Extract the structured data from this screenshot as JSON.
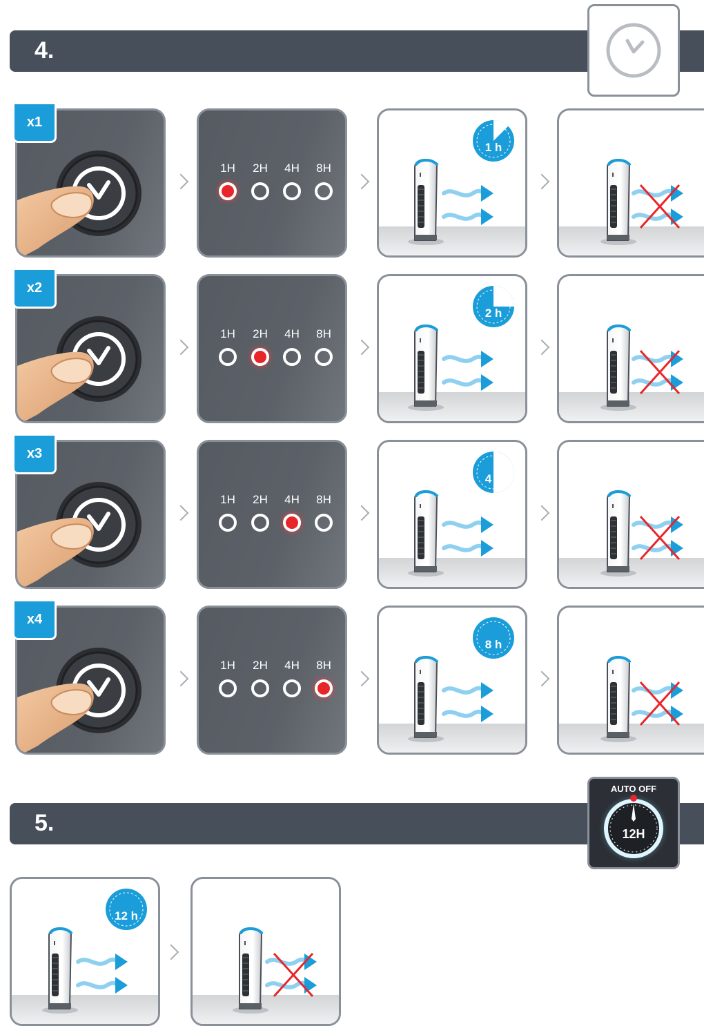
{
  "section4": {
    "number": "4."
  },
  "section5": {
    "number": "5.",
    "auto_off_title": "AUTO OFF",
    "auto_off_value": "12H"
  },
  "led_labels": [
    "1H",
    "2H",
    "4H",
    "8H"
  ],
  "rows": [
    {
      "press_count": "x1",
      "active_led_index": 0,
      "timer_label": "1 h",
      "timer_fraction": 0.125
    },
    {
      "press_count": "x2",
      "active_led_index": 1,
      "timer_label": "2 h",
      "timer_fraction": 0.25
    },
    {
      "press_count": "x3",
      "active_led_index": 2,
      "timer_label": "4 h",
      "timer_fraction": 0.5
    },
    {
      "press_count": "x4",
      "active_led_index": 3,
      "timer_label": "8 h",
      "timer_fraction": 1.0
    }
  ],
  "section5_panel": {
    "timer_label": "12 h",
    "timer_fraction": 0.0
  },
  "colors": {
    "header_bar": "#474f5a",
    "accent_blue": "#1a9dd9",
    "led_red": "#e8262a",
    "cross_red": "#e8262a",
    "panel_border": "#8a9099"
  },
  "icons": {
    "header4": "clock-icon",
    "header5": "auto-off-dial-icon",
    "button": "timer-button-icon",
    "finger": "finger-icon",
    "heater": "tower-heater-icon",
    "airflow": "airflow-arrows-icon",
    "stop": "red-cross-icon"
  }
}
